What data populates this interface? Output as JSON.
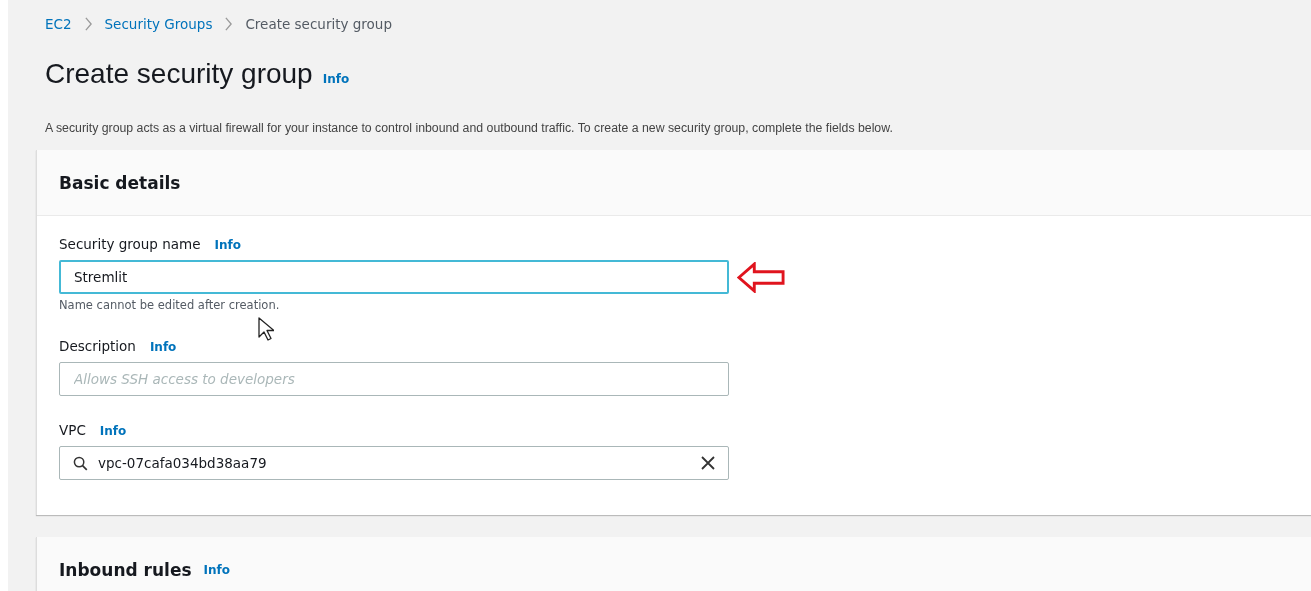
{
  "breadcrumb": [
    {
      "label": "EC2",
      "kind": "link"
    },
    {
      "label": "Security Groups",
      "kind": "link"
    },
    {
      "label": "Create security group",
      "kind": "current"
    }
  ],
  "page": {
    "title": "Create security group",
    "info": "Info",
    "description": "A security group acts as a virtual firewall for your instance to control inbound and outbound traffic. To create a new security group, complete the fields below."
  },
  "basic_details": {
    "heading": "Basic details",
    "fields": [
      {
        "label": "Security group name",
        "info": "Info",
        "kind": "text",
        "value": "Stremlit",
        "focused": true,
        "hint": "Name cannot be edited after creation.",
        "annotated": true
      },
      {
        "label": "Description",
        "info": "Info",
        "kind": "text",
        "placeholder": "Allows SSH access to developers",
        "focused": false,
        "annotated": false
      },
      {
        "label": "VPC",
        "info": "Info",
        "kind": "search",
        "value": "vpc-07cafa034bd38aa79",
        "focused": false,
        "annotated": false
      }
    ]
  },
  "inbound_rules": {
    "heading": "Inbound rules",
    "info": "Info"
  }
}
